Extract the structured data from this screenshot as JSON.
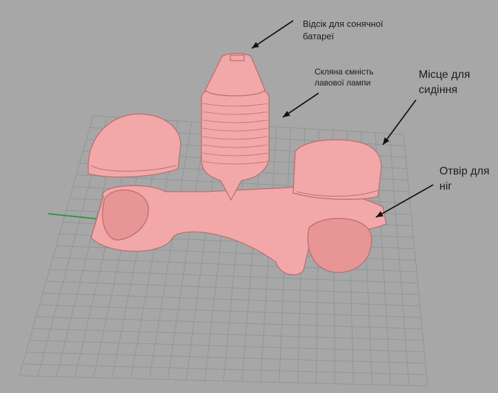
{
  "background": "#a7a7a7",
  "grid_color": "#8f969b",
  "model_color": "#f2a8a8",
  "model_line_color": "#b86e6e",
  "axis_color": "#2e9a3f",
  "annotations": {
    "solar": "Відсік для сонячної\nбатареї",
    "lamp": "Скляна ємність\nлавової лампи",
    "seat": "Місце для\nсидіння",
    "feet": "Отвір для\nніг"
  }
}
